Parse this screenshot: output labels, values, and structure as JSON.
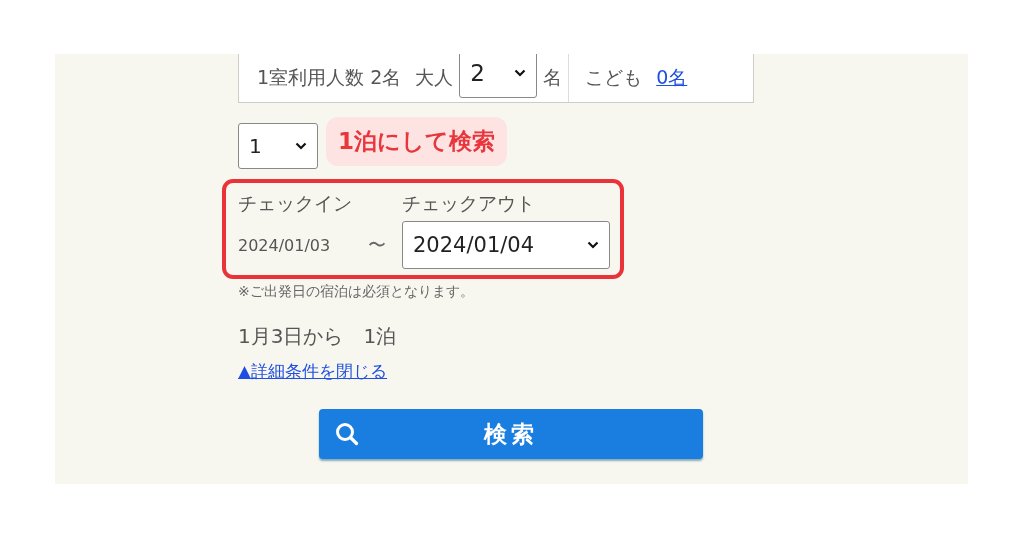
{
  "guests": {
    "label": "1室利用人数 2名",
    "adult_label": "大人",
    "adult_select": {
      "value": "2"
    },
    "adult_unit": "名",
    "child_label": "こども",
    "child_link": "0名"
  },
  "nights": {
    "select": {
      "value": "1"
    },
    "callout": "1泊にして検索"
  },
  "dates": {
    "checkin_label": "チェックイン",
    "checkin_value": "2024/01/03",
    "separator": "〜",
    "checkout_label": "チェックアウト",
    "checkout_select": {
      "value": "2024/01/04"
    }
  },
  "note": "※ご出発日の宿泊は必須となります。",
  "summary": "1月3日から　1泊",
  "toggle_link": "▲詳細条件を閉じる",
  "search_button": "検索"
}
